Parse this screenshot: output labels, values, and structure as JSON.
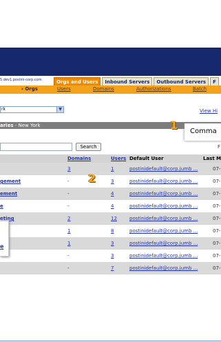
{
  "header": {
    "hostname_fragment": "5.dev1.postini-corp.com"
  },
  "tabs": [
    {
      "label": "Orgs and Users",
      "active": true
    },
    {
      "label": "Inbound Servers",
      "active": false
    },
    {
      "label": "Outbound Servers",
      "active": false
    },
    {
      "label": "F",
      "active": false
    }
  ],
  "subnav": {
    "current": "› Orgs",
    "items": [
      "Users",
      "Domains",
      "Authorizations",
      "Batch"
    ]
  },
  "org_select": {
    "value": "rk"
  },
  "view_history_link": "View Hi",
  "title_bar": {
    "prefix": "aries",
    "org": "New York"
  },
  "callouts": {
    "one_number": "1",
    "one_text": "Comma",
    "two_number": "2"
  },
  "search": {
    "button": "Search",
    "right_fragment": "F"
  },
  "table": {
    "headers": {
      "domains": "Domains",
      "users": "Users",
      "default_user": "Default User",
      "last_modified": "Last M"
    },
    "rows": [
      {
        "name": "",
        "domains": "3",
        "users": "1",
        "default_user": "postinidefault@corp.jumb ...",
        "date": "07-"
      },
      {
        "name": "gement",
        "domains": "-",
        "users": "3",
        "default_user": "postinidefault@corp.jumb ...",
        "date": "07-"
      },
      {
        "name": "ement",
        "domains": "-",
        "users": "4",
        "default_user": "postinidefault@corp.jumb ...",
        "date": "07-"
      },
      {
        "name": "e",
        "domains": "-",
        "users": "4",
        "default_user": "postinidefault@corp.jumb ...",
        "date": "07-"
      },
      {
        "name": "eting",
        "domains": "2",
        "users": "12",
        "default_user": "postinidefault@corp.jumb ...",
        "date": "07-"
      },
      {
        "name": "",
        "domains": "1",
        "users": "8",
        "default_user": "postinidefault@corp.jumb ...",
        "date": "07-"
      },
      {
        "name": "",
        "domains": "1",
        "users": "3",
        "default_user": "postinidefault@corp.jumb ...",
        "date": "07-"
      },
      {
        "name": "",
        "domains": "-",
        "users": "3",
        "default_user": "postinidefault@corp.jumb ...",
        "date": "07-"
      },
      {
        "name": "",
        "domains": "-",
        "users": "7",
        "default_user": "postinidefault@corp.jumb ...",
        "date": "07-"
      }
    ]
  },
  "popup": {
    "label": "e"
  }
}
